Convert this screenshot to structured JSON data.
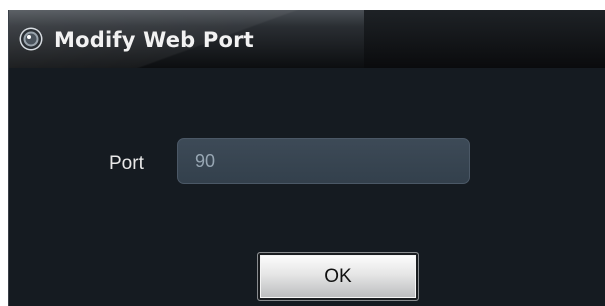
{
  "window": {
    "title": "Modify Web Port",
    "icon": "camera-lens-icon"
  },
  "form": {
    "port_label": "Port",
    "port_value": "90"
  },
  "actions": {
    "ok_label": "OK"
  },
  "colors": {
    "background": "#151b21",
    "input_fill": "#3a4653",
    "input_text": "#97a6b3",
    "label_text": "#e9e9e9",
    "title_text": "#f2f2f2"
  }
}
